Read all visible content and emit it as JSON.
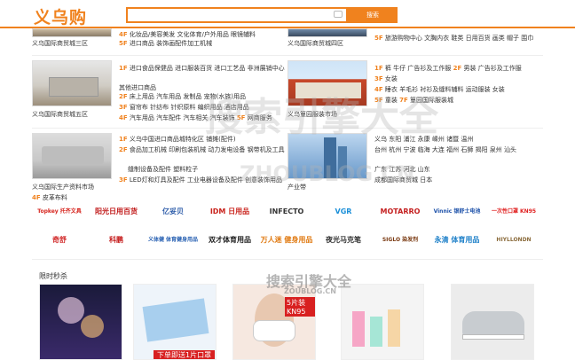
{
  "header": {
    "logo": "义乌购",
    "search_btn": "搜索"
  },
  "sections": [
    {
      "caption": "义乌国际商贸城三区",
      "lines": [
        {
          "f": "4F",
          "t": "化妆品/美容美发 文化体育/户外用品 眼镜辅料"
        },
        {
          "f": "5F",
          "t": "进口商品 装饰画配件加工机械"
        }
      ]
    },
    {
      "caption": "义乌国际商贸城四区",
      "lines": [
        {
          "f": "5F",
          "t": "旅游购物中心 文胸内衣 鞋类 日用百货 画类 帽子 围巾"
        }
      ]
    },
    {
      "caption": "义乌国际商贸城五区",
      "lines": [
        {
          "f": "1F",
          "t": "进口食品保健品 进口服装百货 进口工艺品 非洲展销中心"
        },
        {
          "f": "",
          "t": "其他进口商品"
        },
        {
          "f": "2F",
          "t": "床上用品 汽车用品 发制品 宠物(水族)用品"
        },
        {
          "f": "3F",
          "t": "窗帘布 针纺布 针织原料 编织用品 酒店用品"
        },
        {
          "f": "4F",
          "t": "汽车用品 汽车配件 汽车相关 汽车装饰"
        },
        {
          "f": "5F",
          "t": "网商服务"
        }
      ]
    },
    {
      "caption": "义乌篁园服装市场",
      "lines": [
        {
          "f": "1F",
          "t": "裤 牛仔 广告衫及工作服"
        },
        {
          "f": "2F",
          "t": "男装 广告衫及工作服"
        },
        {
          "f": "3F",
          "t": "女装"
        },
        {
          "f": "4F",
          "t": "睡衣 羊毛衫 衬衫及缝料辅料 运动服装 女装"
        },
        {
          "f": "5F",
          "t": "童装"
        },
        {
          "f": "7F",
          "t": "篁园国际服装城"
        }
      ]
    },
    {
      "caption": "义乌国际生产资料市场",
      "lines": [
        {
          "f": "1F",
          "t": "义乌中国进口商品城特化区 铺摊(配件)"
        },
        {
          "f": "2F",
          "t": "食品加工机械 印刷包装机械 动力发电设备 钢带机及工具"
        },
        {
          "f": "",
          "t": "缝制设备及配件 塑料粒子"
        },
        {
          "f": "3F",
          "t": "LED灯和灯具及配件 工业电器设备及配件 创意装饰用品"
        },
        {
          "f": "4F",
          "t": "皮革布料"
        }
      ]
    },
    {
      "caption": "产业带",
      "lines": [
        {
          "f": "",
          "t": "义乌 东阳 浦江 永康 嵊州 诸暨 温州"
        },
        {
          "f": "",
          "t": "台州 杭州 宁波 临海 大连 福州 石狮 揭阳 泉州 汕头"
        },
        {
          "f": "",
          "t": "广东 江苏 河北 山东"
        },
        {
          "f": "",
          "t": "成都国际商贸城 日本"
        }
      ]
    }
  ],
  "brands": [
    {
      "name": "Topkey 托齐文具",
      "color": "#d6231c"
    },
    {
      "name": "阳光日用百货",
      "color": "#c01818"
    },
    {
      "name": "亿妥贝",
      "color": "#2a5aa8"
    },
    {
      "name": "IDM 日用品",
      "color": "#c9231c"
    },
    {
      "name": "INFECTO",
      "color": "#333333"
    },
    {
      "name": "VGR",
      "color": "#1b8fd8"
    },
    {
      "name": "MOTARRO",
      "color": "#c42020"
    },
    {
      "name": "Vinnic 银舒士电池",
      "color": "#1a4fa8"
    },
    {
      "name": "一次性口罩 KN95",
      "color": "#e02020"
    },
    {
      "name": "奇舒",
      "color": "#d12a2a"
    },
    {
      "name": "科鹏",
      "color": "#c62020"
    },
    {
      "name": "义体健 体育健身用品",
      "color": "#2a62b3"
    },
    {
      "name": "双才体育用品",
      "color": "#1c1c1c"
    },
    {
      "name": "万人迷 健身用品",
      "color": "#e07a12"
    },
    {
      "name": "夜光马克笔",
      "color": "#333333"
    },
    {
      "name": "SIGLO 染发剂",
      "color": "#7a3a12"
    },
    {
      "name": "永清 体育用品",
      "color": "#1c7fc8"
    },
    {
      "name": "HIYLLONDN",
      "color": "#8a6a3a"
    }
  ],
  "flash": {
    "title": "限时秒杀",
    "badge": "5片装 KN95",
    "banner": "下单即送1片口罩"
  },
  "watermark": {
    "a": "搜索引擎大全",
    "b": "ZHOUBLOG.CN",
    "c": "搜索引擎大全",
    "d": "ZOUBLOG.CN"
  }
}
